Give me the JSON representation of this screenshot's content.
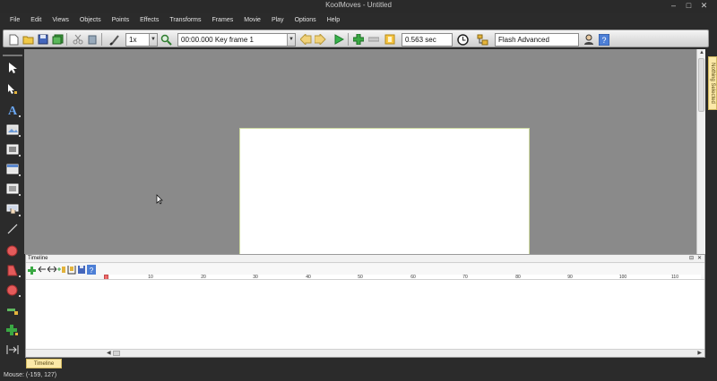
{
  "window": {
    "title": "KoolMoves - Untitled",
    "min_glyph": "–",
    "max_glyph": "□",
    "close_glyph": "✕"
  },
  "menu": {
    "items": [
      "File",
      "Edit",
      "Views",
      "Objects",
      "Points",
      "Effects",
      "Transforms",
      "Frames",
      "Movie",
      "Play",
      "Options",
      "Help"
    ]
  },
  "toolbar": {
    "zoom_value": "1x",
    "frame_label": "00:00.000  Key frame 1",
    "duration": "0.563 sec",
    "export_format": "Flash Advanced"
  },
  "side_tab": {
    "label": "Nothing Selected"
  },
  "timeline": {
    "panel_title": "Timeline",
    "pin_glyph": "⊟",
    "close_glyph": "✕",
    "ruler_numbers": [
      "10",
      "20",
      "30",
      "40",
      "50",
      "60",
      "70",
      "80",
      "90",
      "100",
      "110"
    ],
    "bottom_tab": "Timeline"
  },
  "status": {
    "mouse_text": "Mouse: (-159, 127)"
  },
  "colors": {
    "chrome_bg": "#2b2b2b",
    "workspace_bg": "#8a8a8a",
    "stage_bg": "#ffffff",
    "tab_yellow": "#fbe9a8",
    "playhead_red": "#ef6b6b"
  }
}
